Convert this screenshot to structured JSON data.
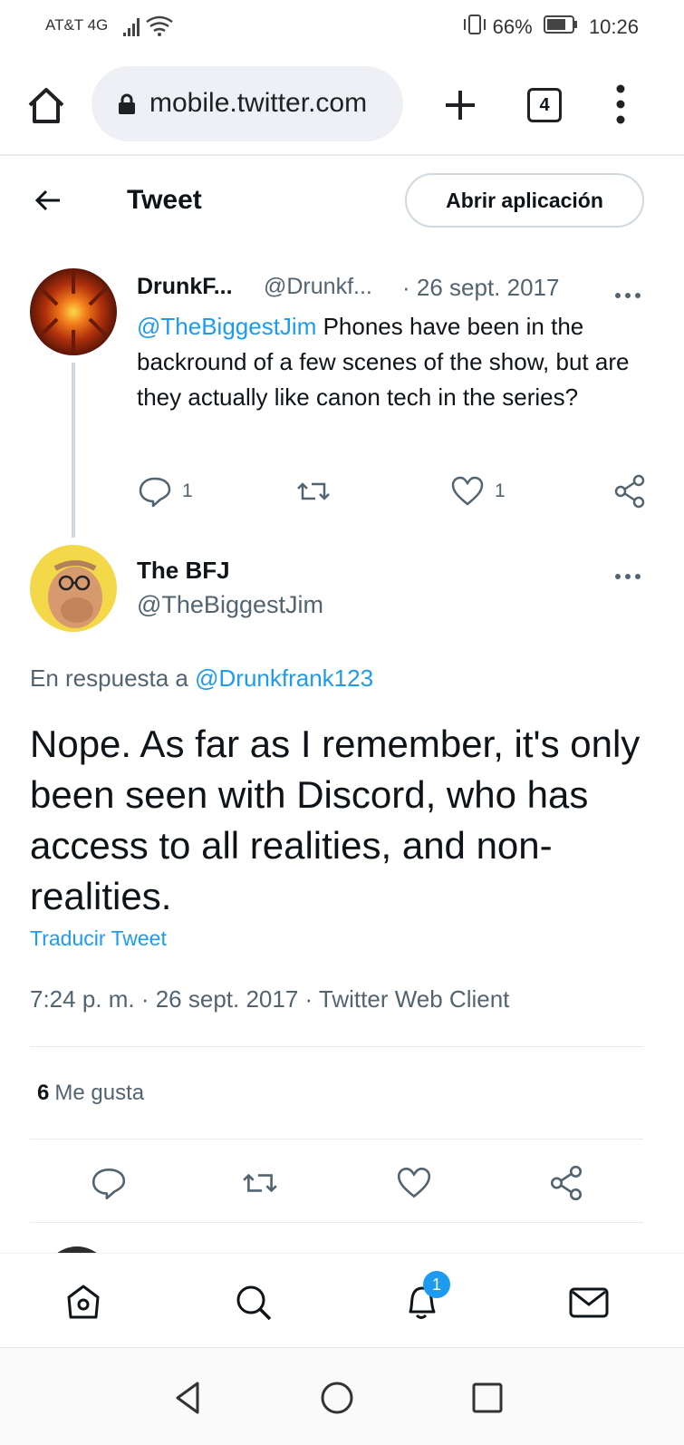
{
  "status_bar": {
    "carrier": "AT&T 4G",
    "battery": "66%",
    "time": "10:26"
  },
  "browser": {
    "url": "mobile.twitter.com",
    "tab_count": "4"
  },
  "header": {
    "title": "Tweet",
    "open_app": "Abrir aplicación"
  },
  "parent_tweet": {
    "name": "DrunkF...",
    "handle": "@Drunkf...",
    "date": "· 26 sept. 2017",
    "mention": "@TheBiggestJim",
    "text": " Phones have been in the backround of a few scenes of the show, but are they actually like canon tech in the series?",
    "reply_count": "1",
    "like_count": "1"
  },
  "main_tweet": {
    "name": "The BFJ",
    "handle": "@TheBiggestJim",
    "reply_prefix": "En respuesta a ",
    "reply_to": "@Drunkfrank123",
    "text": "Nope. As far as I remember, it's only been seen with Discord, who has access to all realities, and non-realities.",
    "translate": "Traducir Tweet",
    "meta": "7:24 p. m. · 26 sept. 2017 · Twitter Web Client",
    "likes_count": "6",
    "likes_label": "Me gusta"
  },
  "bottom_nav": {
    "notification_badge": "1"
  },
  "colors": {
    "accent": "#1d9bf0",
    "secondary_text": "#536471",
    "divider": "#e7e9ea"
  }
}
